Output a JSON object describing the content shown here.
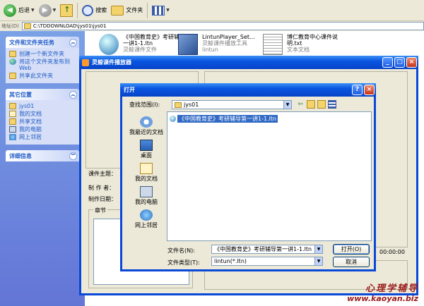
{
  "toolbar": {
    "back_label": "后退",
    "search_label": "搜索",
    "folders_label": "文件夹"
  },
  "address": {
    "label": "地址(D)",
    "path": "C:\\TDDOWNLOAD\\jys01\\jys01"
  },
  "taskpane": {
    "file_tasks": {
      "title": "文件和文件夹任务",
      "items": [
        {
          "label": "创建一个新文件夹",
          "icon": "new-folder-icon"
        },
        {
          "label": "将这个文件夹发布到 Web",
          "icon": "publish-web-icon"
        },
        {
          "label": "共享此文件夹",
          "icon": "share-folder-icon"
        }
      ]
    },
    "other_places": {
      "title": "其它位置",
      "items": [
        {
          "label": "jys01",
          "icon": "folder-icon"
        },
        {
          "label": "我的文档",
          "icon": "my-documents-icon"
        },
        {
          "label": "共享文档",
          "icon": "shared-documents-icon"
        },
        {
          "label": "我的电脑",
          "icon": "my-computer-icon"
        },
        {
          "label": "网上邻居",
          "icon": "network-places-icon"
        }
      ]
    },
    "details": {
      "title": "详细信息"
    }
  },
  "files": [
    {
      "name": "《中国教育史》考研辅导第一讲1-1.ltn",
      "type": "灵鲸课件文件",
      "icon": "media-file-icon"
    },
    {
      "name": "LintunPlayer_Set...",
      "type": "灵鲸课件播放工具",
      "sub": "lintun",
      "icon": "installer-icon"
    },
    {
      "name": "博仁教育中心课件说明.txt",
      "type": "文本文档",
      "icon": "text-file-icon"
    }
  ],
  "player": {
    "title": "灵鲸课件播放器",
    "labels": {
      "topic": "课件主题：",
      "author": "制 作 者：",
      "date": "制作日期：",
      "chapter": "章节"
    },
    "time": "00:00:00"
  },
  "open_dialog": {
    "title": "打开",
    "lookin_label": "查找范围(I):",
    "lookin_value": "jys01",
    "places": [
      "我最近的文档",
      "桌面",
      "我的文档",
      "我的电脑",
      "网上邻居"
    ],
    "selected_file": "《中国教育史》考研辅导第一讲1-1.ltn",
    "filename_label": "文件名(N):",
    "filename_value": "《中国教育史》考研辅导第一讲1-1.ltn",
    "filetype_label": "文件类型(T):",
    "filetype_value": "lintun(*.ltn)",
    "open_button": "打开(O)",
    "cancel_button": "取消"
  },
  "watermark": {
    "line1": "心理学辅导",
    "line2": "www.kaoyan.biz"
  },
  "colors": {
    "xp_blue": "#0a48d8",
    "taskpane": "#7aa1e6",
    "selection": "#316ac5",
    "watermark": "#9a1a1a"
  }
}
